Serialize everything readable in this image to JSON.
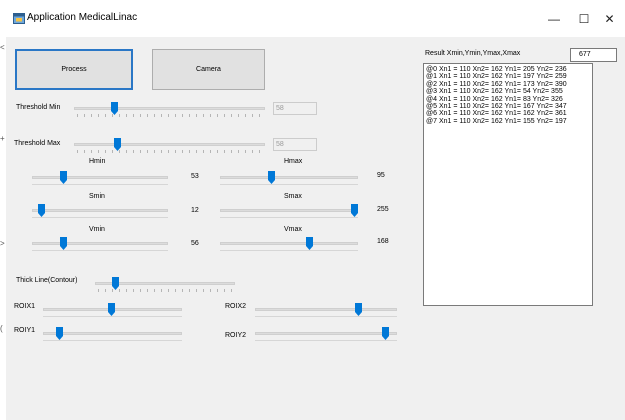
{
  "window": {
    "title": "Application MedicalLinac",
    "minimize_glyph": "—",
    "maximize_glyph": "☐",
    "close_glyph": "✕"
  },
  "buttons": {
    "process_label": "Process",
    "camera_label": "Camera"
  },
  "threshold": {
    "min": {
      "label": "Threshold Min",
      "value": "58",
      "level": 0.2
    },
    "max": {
      "label": "Threshold Max",
      "value": "58",
      "level": 0.22
    }
  },
  "hsv": {
    "hmin": {
      "label": "Hmin",
      "value": "53",
      "level": 0.22
    },
    "hmax": {
      "label": "Hmax",
      "value": "95",
      "level": 0.37
    },
    "smin": {
      "label": "Smin",
      "value": "12",
      "level": 0.05
    },
    "smax": {
      "label": "Smax",
      "value": "255",
      "level": 1.0
    },
    "vmin": {
      "label": "Vmin",
      "value": "56",
      "level": 0.22
    },
    "vmax": {
      "label": "Vmax",
      "value": "168",
      "level": 0.66
    }
  },
  "contour": {
    "label": "Thick Line(Contour)",
    "level": 0.13
  },
  "roi": {
    "x1": {
      "label": "ROIX1",
      "level": 0.49
    },
    "y1": {
      "label": "ROIY1",
      "level": 0.1
    },
    "x2": {
      "label": "ROIX2",
      "level": 0.74
    },
    "y2": {
      "label": "ROIY2",
      "level": 0.94
    }
  },
  "result": {
    "label": "Result Xmin,Ymin,Ymax,Xmax",
    "value": "677",
    "rows": [
      "@0  Xn1 = 110 Xn2= 162 Yn1= 205 Yn2= 236",
      "@1  Xn1 = 110 Xn2= 162 Yn1= 197 Yn2= 259",
      "@2  Xn1 = 110 Xn2= 162 Yn1= 173 Yn2= 390",
      "@3  Xn1 = 110 Xn2= 162 Yn1= 54 Yn2= 355",
      "@4  Xn1 = 110 Xn2= 162 Yn1= 83 Yn2= 326",
      "@5  Xn1 = 110 Xn2= 162 Yn1= 167 Yn2= 347",
      "@6  Xn1 = 110 Xn2= 162 Yn1= 162 Yn2= 361",
      "@7  Xn1 = 110 Xn2= 162 Yn1= 155 Yn2= 197"
    ]
  },
  "colors": {
    "accent": "#0078d7",
    "client_bg": "#f0f0f0",
    "button_bg": "#e1e1e1",
    "default_button_border": "#2a77c6"
  },
  "icons": {
    "app": "app-window-icon",
    "minimize": "minimize-icon",
    "maximize": "maximize-icon",
    "close": "close-icon",
    "thumb": "slider-thumb-icon"
  }
}
